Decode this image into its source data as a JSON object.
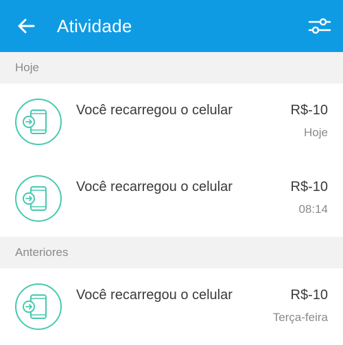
{
  "header": {
    "title": "Atividade",
    "back_icon": "arrow-left-icon",
    "filter_icon": "sliders-icon",
    "color": "#0f9be3"
  },
  "sections": [
    {
      "title": "Hoje",
      "items": [
        {
          "label": "Você recarregou o celular",
          "amount": "R$-10",
          "date": "Hoje",
          "icon": "phone-recharge-icon"
        },
        {
          "label": "Você recarregou o celular",
          "amount": "R$-10",
          "date": "08:14",
          "icon": "phone-recharge-icon"
        }
      ]
    },
    {
      "title": "Anteriores",
      "items": [
        {
          "label": "Você recarregou o celular",
          "amount": "R$-10",
          "date": "Terça-feira",
          "icon": "phone-recharge-icon"
        }
      ]
    }
  ],
  "icon_color": "#47c9ae"
}
